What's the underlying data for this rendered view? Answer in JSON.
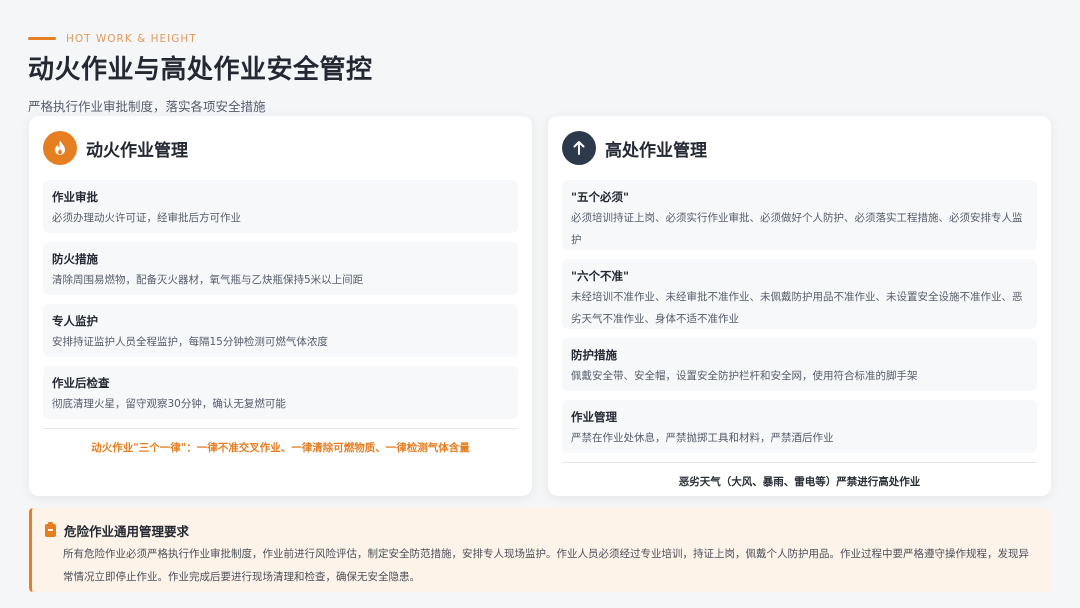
{
  "header": {
    "eyebrow": "HOT WORK & HEIGHT",
    "title": "动火作业与高处作业安全管控",
    "subtitle": "严格执行作业审批制度，落实各项安全措施"
  },
  "hot_work": {
    "icon": "flame-icon",
    "title": "动火作业管理",
    "items": [
      {
        "title": "作业审批",
        "text": "必须办理动火许可证，经审批后方可作业"
      },
      {
        "title": "防火措施",
        "text": "清除周围易燃物，配备灭火器材，氧气瓶与乙炔瓶保持5米以上间距"
      },
      {
        "title": "专人监护",
        "text": "安排持证监护人员全程监护，每隔15分钟检测可燃气体浓度"
      },
      {
        "title": "作业后检查",
        "text": "彻底清理火星，留守观察30分钟，确认无复燃可能"
      }
    ],
    "footer": "动火作业\"三个一律\"：一律不准交叉作业、一律清除可燃物质、一律检测气体含量"
  },
  "height_work": {
    "icon": "arrow-up-icon",
    "title": "高处作业管理",
    "items": [
      {
        "title": "\"五个必须\"",
        "text": "必须培训持证上岗、必须实行作业审批、必须做好个人防护、必须落实工程措施、必须安排专人监护"
      },
      {
        "title": "\"六个不准\"",
        "text": "未经培训不准作业、未经审批不准作业、未佩戴防护用品不准作业、未设置安全设施不准作业、恶劣天气不准作业、身体不适不准作业"
      },
      {
        "title": "防护措施",
        "text": "佩戴安全带、安全帽，设置安全防护栏杆和安全网，使用符合标准的脚手架"
      },
      {
        "title": "作业管理",
        "text": "严禁在作业处休息，严禁抛掷工具和材料，严禁酒后作业"
      }
    ],
    "footer": "恶劣天气（大风、暴雨、雷电等）严禁进行高处作业"
  },
  "notice": {
    "icon": "clipboard-icon",
    "title": "危险作业通用管理要求",
    "text": "所有危险作业必须严格执行作业审批制度，作业前进行风险评估，制定安全防范措施，安排专人现场监护。作业人员必须经过专业培训，持证上岗，佩戴个人防护用品。作业过程中要严格遵守操作规程，发现异常情况立即停止作业。作业完成后要进行现场清理和检查，确保无安全隐患。"
  },
  "colors": {
    "accent": "#e67e22",
    "dark_badge": "#2c3a4b",
    "notice_bg": "#fdf3e8"
  }
}
